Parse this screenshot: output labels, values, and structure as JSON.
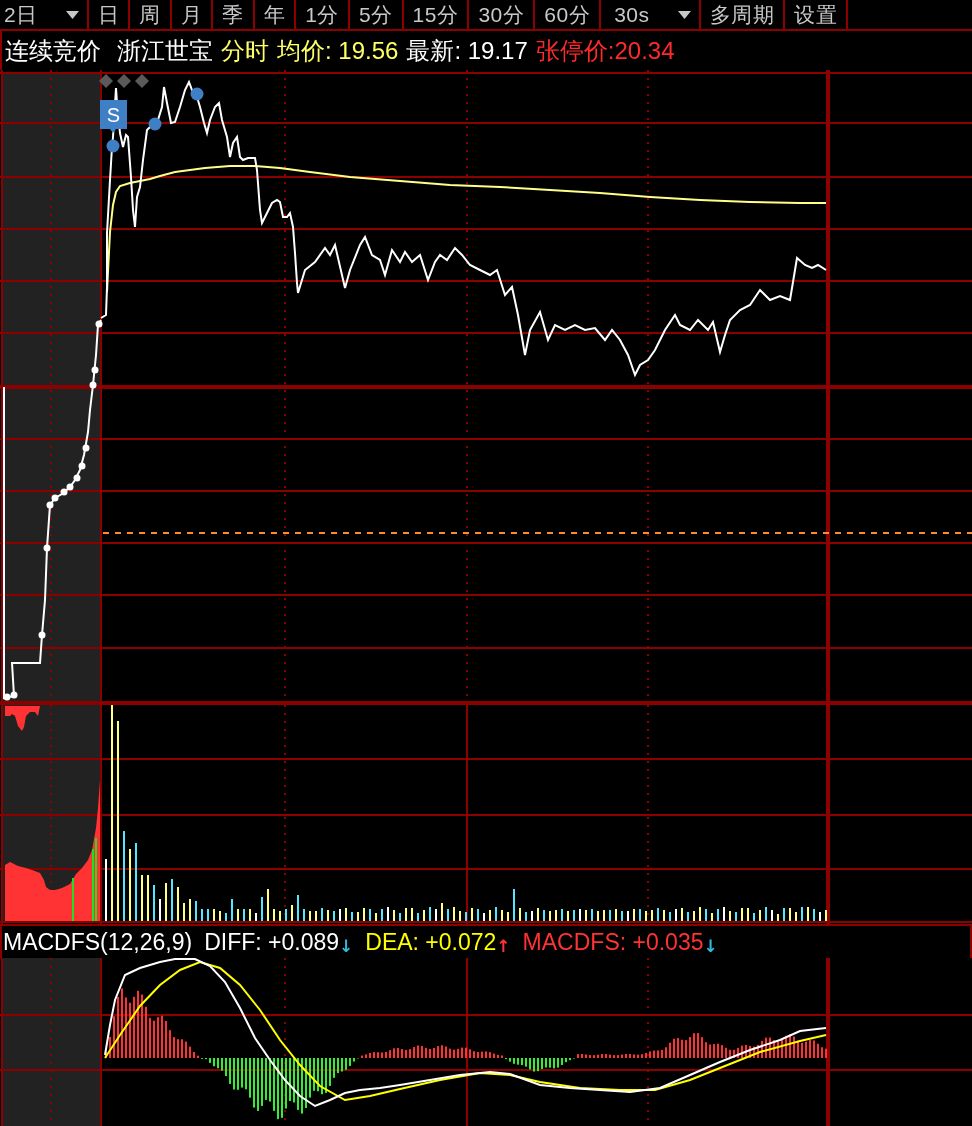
{
  "toolbar": {
    "tabs": [
      {
        "label": "2日",
        "kind": "dropdown"
      },
      {
        "label": "日",
        "kind": "tab"
      },
      {
        "label": "周",
        "kind": "tab"
      },
      {
        "label": "月",
        "kind": "tab"
      },
      {
        "label": "季",
        "kind": "tab"
      },
      {
        "label": "年",
        "kind": "tab"
      },
      {
        "label": "1分",
        "kind": "tab"
      },
      {
        "label": "5分",
        "kind": "tab"
      },
      {
        "label": "15分",
        "kind": "tab"
      },
      {
        "label": "30分",
        "kind": "tab"
      },
      {
        "label": "60分",
        "kind": "tab"
      },
      {
        "label": "30s",
        "kind": "dropdown"
      },
      {
        "label": "多周期",
        "kind": "tab"
      },
      {
        "label": "设置",
        "kind": "tab"
      }
    ]
  },
  "quote_line": {
    "status": "连续竞价",
    "stock_name": "浙江世宝",
    "mode": "分时",
    "average_price": "均价: 19.56",
    "last_price": "最新: 19.17",
    "limit_up_price": "张停价:20.34"
  },
  "price_panel": {
    "badge": "S"
  },
  "indicator": {
    "title": "MACDFS(12,26,9)",
    "readings": [
      {
        "text": "DIFF: +0.089",
        "color": "#ffffff",
        "arrow": {
          "symbol": "↓",
          "color": "#33bbdd"
        }
      },
      {
        "text": "DEA: +0.072",
        "color": "#ffff00",
        "arrow": {
          "symbol": "↑",
          "color": "#ff3333"
        }
      },
      {
        "text": "MACDFS: +0.035",
        "color": "#ff3333",
        "arrow": {
          "symbol": "↓",
          "color": "#33bbdd"
        }
      }
    ]
  }
}
